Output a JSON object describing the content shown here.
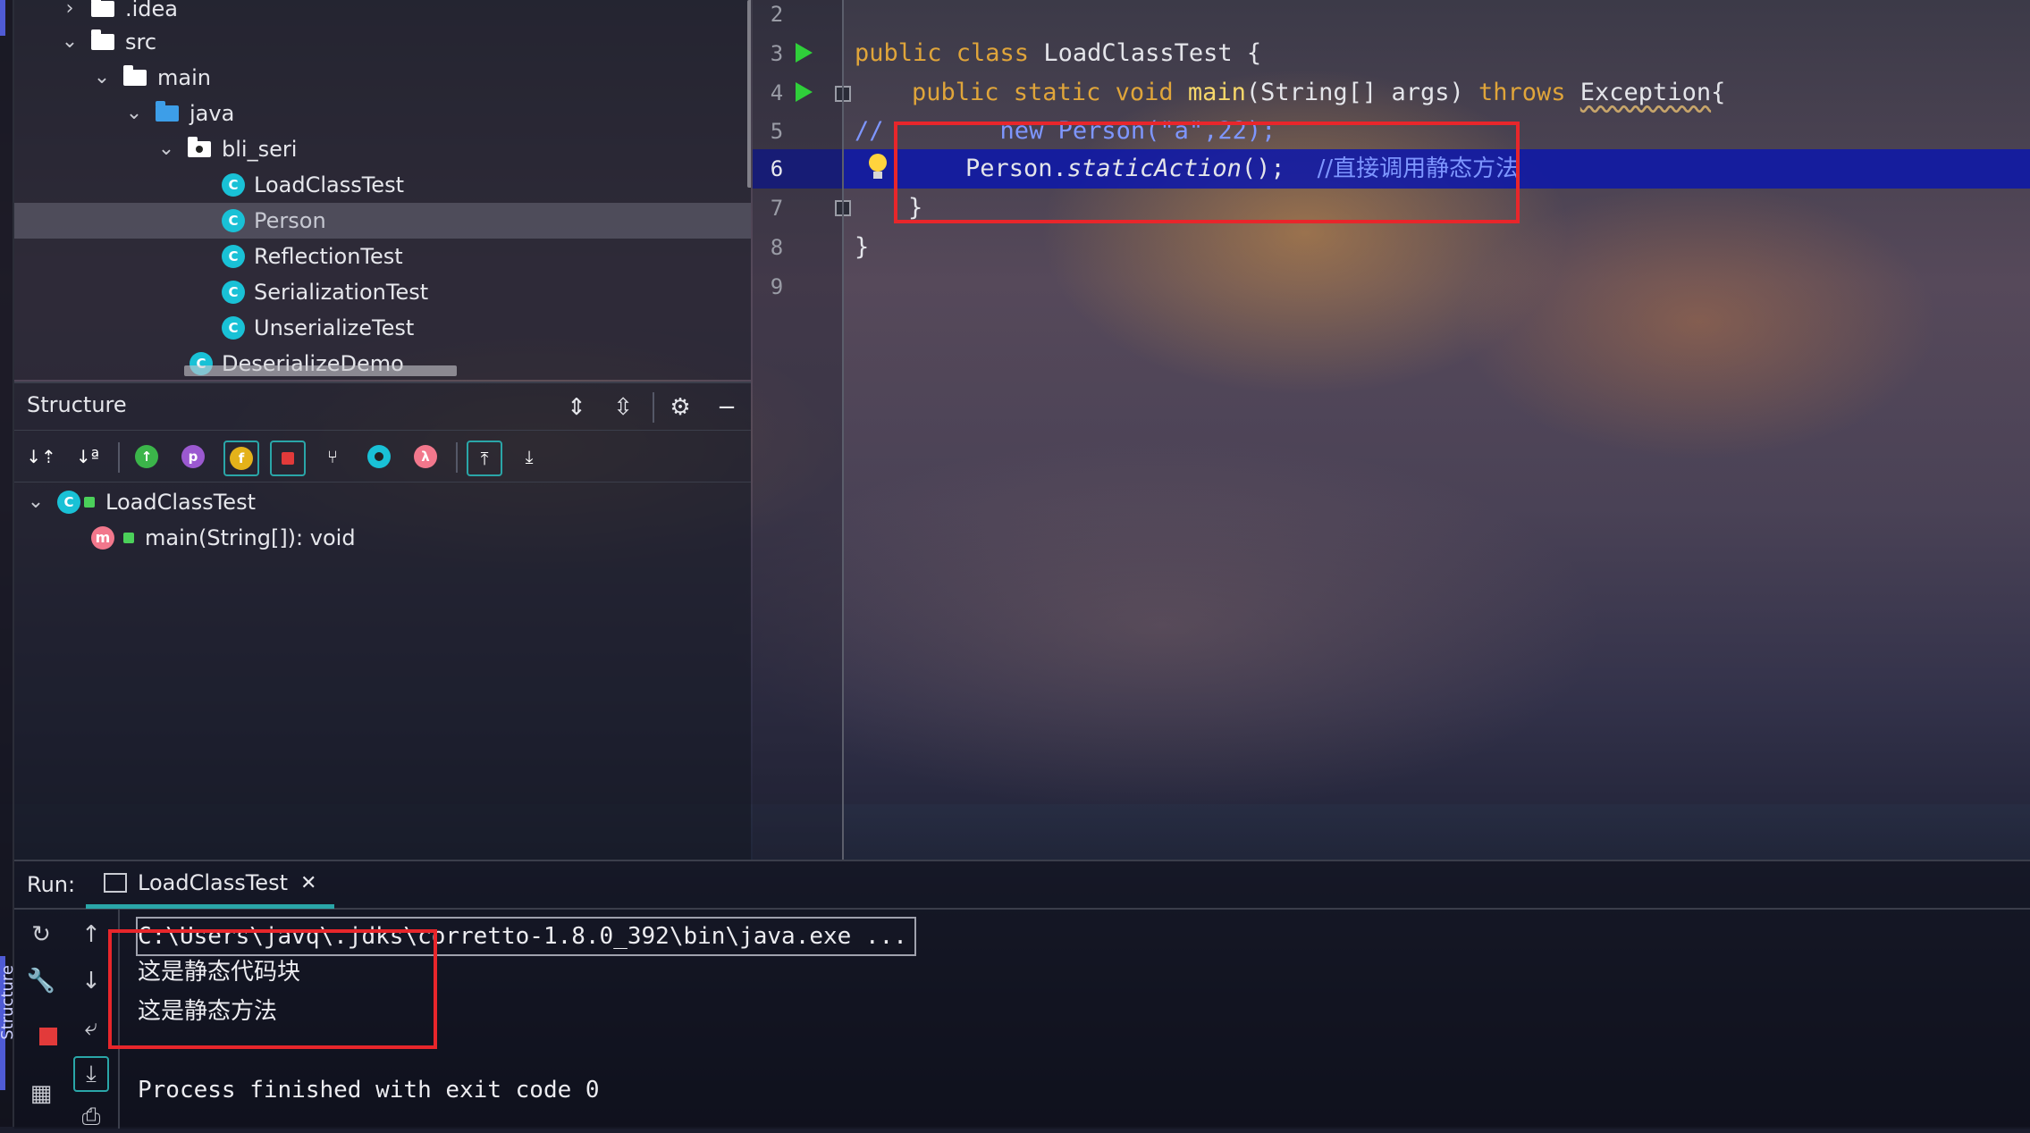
{
  "project_tree": {
    "items": [
      {
        "label": ".idea",
        "kind": "folder",
        "expanded": false
      },
      {
        "label": "src",
        "kind": "folder",
        "expanded": true
      },
      {
        "label": "main",
        "kind": "folder",
        "expanded": true
      },
      {
        "label": "java",
        "kind": "source-folder",
        "expanded": true
      },
      {
        "label": "bli_seri",
        "kind": "package",
        "expanded": true
      },
      {
        "label": "LoadClassTest",
        "kind": "class"
      },
      {
        "label": "Person",
        "kind": "class",
        "selected": true
      },
      {
        "label": "ReflectionTest",
        "kind": "class"
      },
      {
        "label": "SerializationTest",
        "kind": "class"
      },
      {
        "label": "UnserializeTest",
        "kind": "class"
      },
      {
        "label": "DeserializeDemo",
        "kind": "class"
      }
    ]
  },
  "structure": {
    "title": "Structure",
    "tree": {
      "class_name": "LoadClassTest",
      "method": "main(String[]): void"
    },
    "icons": {
      "class_letter": "C",
      "method_letter": "m",
      "property_letter": "p",
      "field_letter": "f",
      "lambda_letter": "λ"
    }
  },
  "editor": {
    "line_numbers": [
      "2",
      "3",
      "4",
      "5",
      "6",
      "7",
      "8",
      "9"
    ],
    "code": {
      "l3_kw": "public class ",
      "l3_rest": "LoadClassTest {",
      "l4_kw1": "public static void ",
      "l4_fn": "main",
      "l4_mid": "(String[] args) ",
      "l4_kw2": "throws ",
      "l4_exc": "Exception",
      "l4_brace": "{",
      "l5_comment": "//        new Person(\"a\",22);",
      "l6_obj": "Person.",
      "l6_call": "staticAction",
      "l6_end": "();",
      "l6_semicolon_hint": "",
      "l6_comment": "//直接调用静态方法",
      "l7": "}",
      "l8": "}"
    }
  },
  "run_panel": {
    "title": "Run:",
    "tab_label": "LoadClassTest",
    "console": {
      "command": "C:\\Users\\javq\\.jdks\\corretto-1.8.0_392\\bin\\java.exe ...",
      "line1": "这是静态代码块",
      "line2": "这是静态方法",
      "exit": "Process finished with exit code 0"
    }
  },
  "side_label": "Structure",
  "colors": {
    "keyword": "#e0a53a",
    "function": "#f7d86a",
    "comment": "#7e96ff",
    "current_line": "#0c16aa",
    "highlight_box": "#e8262b",
    "accent": "#2aa6a8"
  }
}
